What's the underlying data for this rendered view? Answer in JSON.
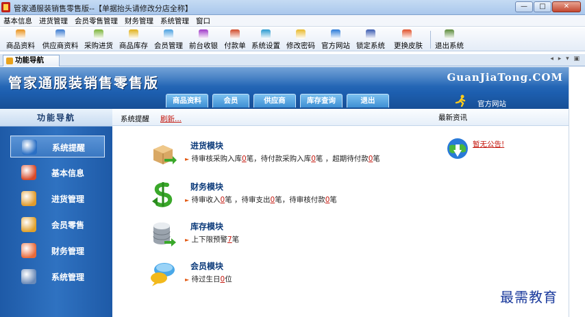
{
  "window": {
    "title": "管家通服装销售零售版--【单据抬头请修改分店全称】",
    "buttons": {
      "minimize": "—",
      "maximize": "□",
      "close": "✕"
    }
  },
  "menu": {
    "items": [
      "基本信息",
      "进货管理",
      "会员零售管理",
      "财务管理",
      "系统管理",
      "窗口"
    ]
  },
  "toolbar": {
    "items": [
      {
        "label": "商品资料",
        "icon": "product-icon",
        "color": "#e8901a"
      },
      {
        "label": "供应商资料",
        "icon": "supplier-icon",
        "color": "#3a7ad0"
      },
      {
        "label": "采购进货",
        "icon": "purchase-icon",
        "color": "#7bb33a"
      },
      {
        "label": "商品库存",
        "icon": "inventory-icon",
        "color": "#e0b01a"
      },
      {
        "label": "会员管理",
        "icon": "member-icon",
        "color": "#4aa0e0"
      },
      {
        "label": "前台收银",
        "icon": "cashier-icon",
        "color": "#a03ac8"
      },
      {
        "label": "付款单",
        "icon": "payment-icon",
        "color": "#d04a2a"
      },
      {
        "label": "系统设置",
        "icon": "settings-icon",
        "color": "#2a9ad0"
      },
      {
        "label": "修改密码",
        "icon": "password-icon",
        "color": "#e8b82a"
      },
      {
        "label": "官方网站",
        "icon": "website-icon",
        "color": "#2a7ad8"
      },
      {
        "label": "锁定系统",
        "icon": "lock-icon",
        "color": "#3a5ab0"
      },
      {
        "label": "更换皮肤",
        "icon": "skin-icon",
        "color": "#e0502a"
      },
      {
        "label": "退出系统",
        "icon": "exit-icon",
        "color": "#5a8a3a"
      }
    ]
  },
  "tab": {
    "label": "功能导航"
  },
  "banner": {
    "brand": "管家通服装销售零售版",
    "site": "GuanJiaTong.COM",
    "tabs": [
      "商品资料",
      "会员",
      "供应商",
      "库存查询",
      "退出"
    ],
    "official_site": "官方网站"
  },
  "sidebar": {
    "heading": "功能导航",
    "items": [
      {
        "label": "系统提醒",
        "icon": "info-icon",
        "color": "#2a6fc4"
      },
      {
        "label": "基本信息",
        "icon": "cubes-icon",
        "color": "#d84a2a"
      },
      {
        "label": "进货管理",
        "icon": "box-icon",
        "color": "#e09a2a"
      },
      {
        "label": "会员零售",
        "icon": "member-retail-icon",
        "color": "#e0a02a"
      },
      {
        "label": "财务管理",
        "icon": "finance-icon",
        "color": "#e86a3a"
      },
      {
        "label": "系统管理",
        "icon": "system-icon",
        "color": "#6a8ab8"
      }
    ]
  },
  "main": {
    "reminder_label": "系统提醒",
    "refresh_label": "刷新...",
    "news_label": "最新资讯",
    "notice": "暂无公告!",
    "modules": [
      {
        "title": "进货模块",
        "icon": "purchase-module-icon",
        "parts": [
          {
            "t": "待审核采购入库"
          },
          {
            "n": "0"
          },
          {
            "t": "笔，待付款采购入库"
          },
          {
            "n": "0"
          },
          {
            "t": "笔 ，超期待付款"
          },
          {
            "n": "0"
          },
          {
            "t": "笔"
          }
        ]
      },
      {
        "title": "财务模块",
        "icon": "finance-module-icon",
        "parts": [
          {
            "t": "待审收入"
          },
          {
            "n": "0"
          },
          {
            "t": "笔 ，待审支出"
          },
          {
            "n": "0"
          },
          {
            "t": "笔，待审核付款"
          },
          {
            "n": "0"
          },
          {
            "t": "笔"
          }
        ]
      },
      {
        "title": "库存模块",
        "icon": "inventory-module-icon",
        "parts": [
          {
            "t": "上下限预警"
          },
          {
            "n": "7"
          },
          {
            "t": "笔"
          }
        ]
      },
      {
        "title": "会员模块",
        "icon": "member-module-icon",
        "parts": [
          {
            "t": "待过生日"
          },
          {
            "n": "0"
          },
          {
            "t": "位"
          }
        ]
      }
    ]
  },
  "watermark": "最需教育"
}
